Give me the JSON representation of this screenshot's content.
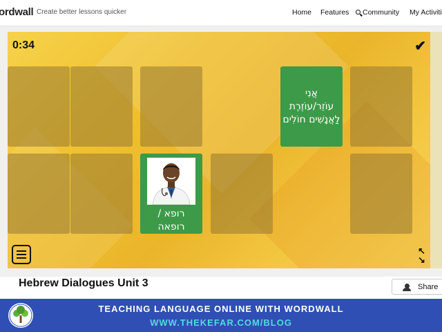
{
  "header": {
    "logo": "ordwall",
    "tagline": "Create better lessons quicker",
    "nav": {
      "home": "Home",
      "features": "Features",
      "community": "Community",
      "activities": "My Activitie"
    }
  },
  "game": {
    "timer": "0:34",
    "cards": {
      "helper_text": "אֲנִי עוֹזֵר/עוֹזֶרֶת לַאֲנָשִׁים חוֹלִים",
      "doctor_text": "רופא / רופאה"
    }
  },
  "activity": {
    "title": "Hebrew Dialogues Unit 3",
    "share_label": "Share"
  },
  "banner": {
    "line1": "TEACHING LANGUAGE ONLINE WITH WORDWALL",
    "line2": "WWW.THEKEFAR.COM/BLOG"
  },
  "colors": {
    "card_green": "#3d9a48",
    "banner_blue": "#2f4fb4",
    "banner_accent": "#56d8e0",
    "game_yellow": "#f0c030"
  }
}
